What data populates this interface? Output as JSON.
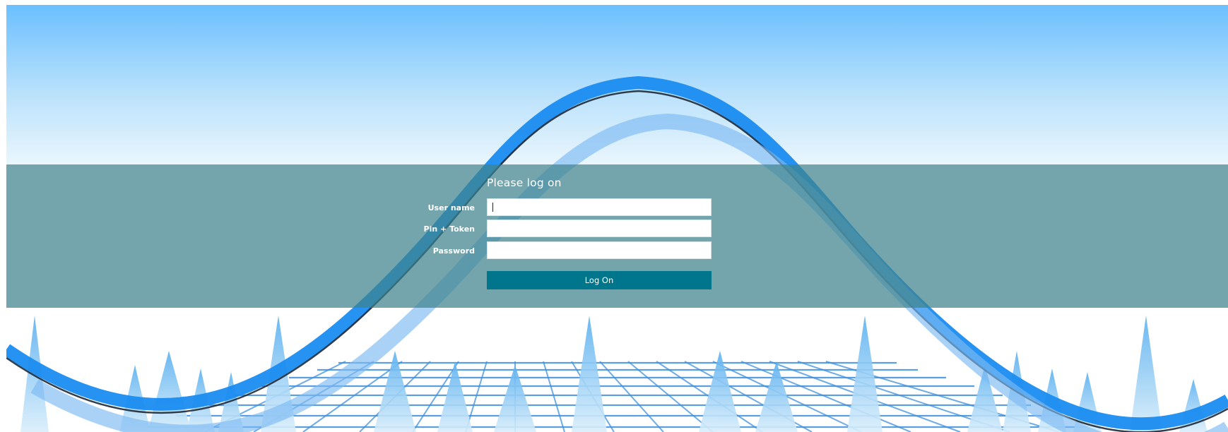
{
  "login": {
    "heading": "Please log on",
    "fields": [
      {
        "label": "User name",
        "value": "",
        "placeholder": ""
      },
      {
        "label": "Pin + Token",
        "value": "",
        "placeholder": ""
      },
      {
        "label": "Password",
        "value": "",
        "placeholder": ""
      }
    ],
    "submit_label": "Log On"
  },
  "colors": {
    "band": "#3e828c",
    "button": "#00768c",
    "sky_top": "#6bc0ff",
    "wave_dark": "#0f82e6"
  },
  "background": {
    "description_icon": "wave-and-grid-background"
  }
}
